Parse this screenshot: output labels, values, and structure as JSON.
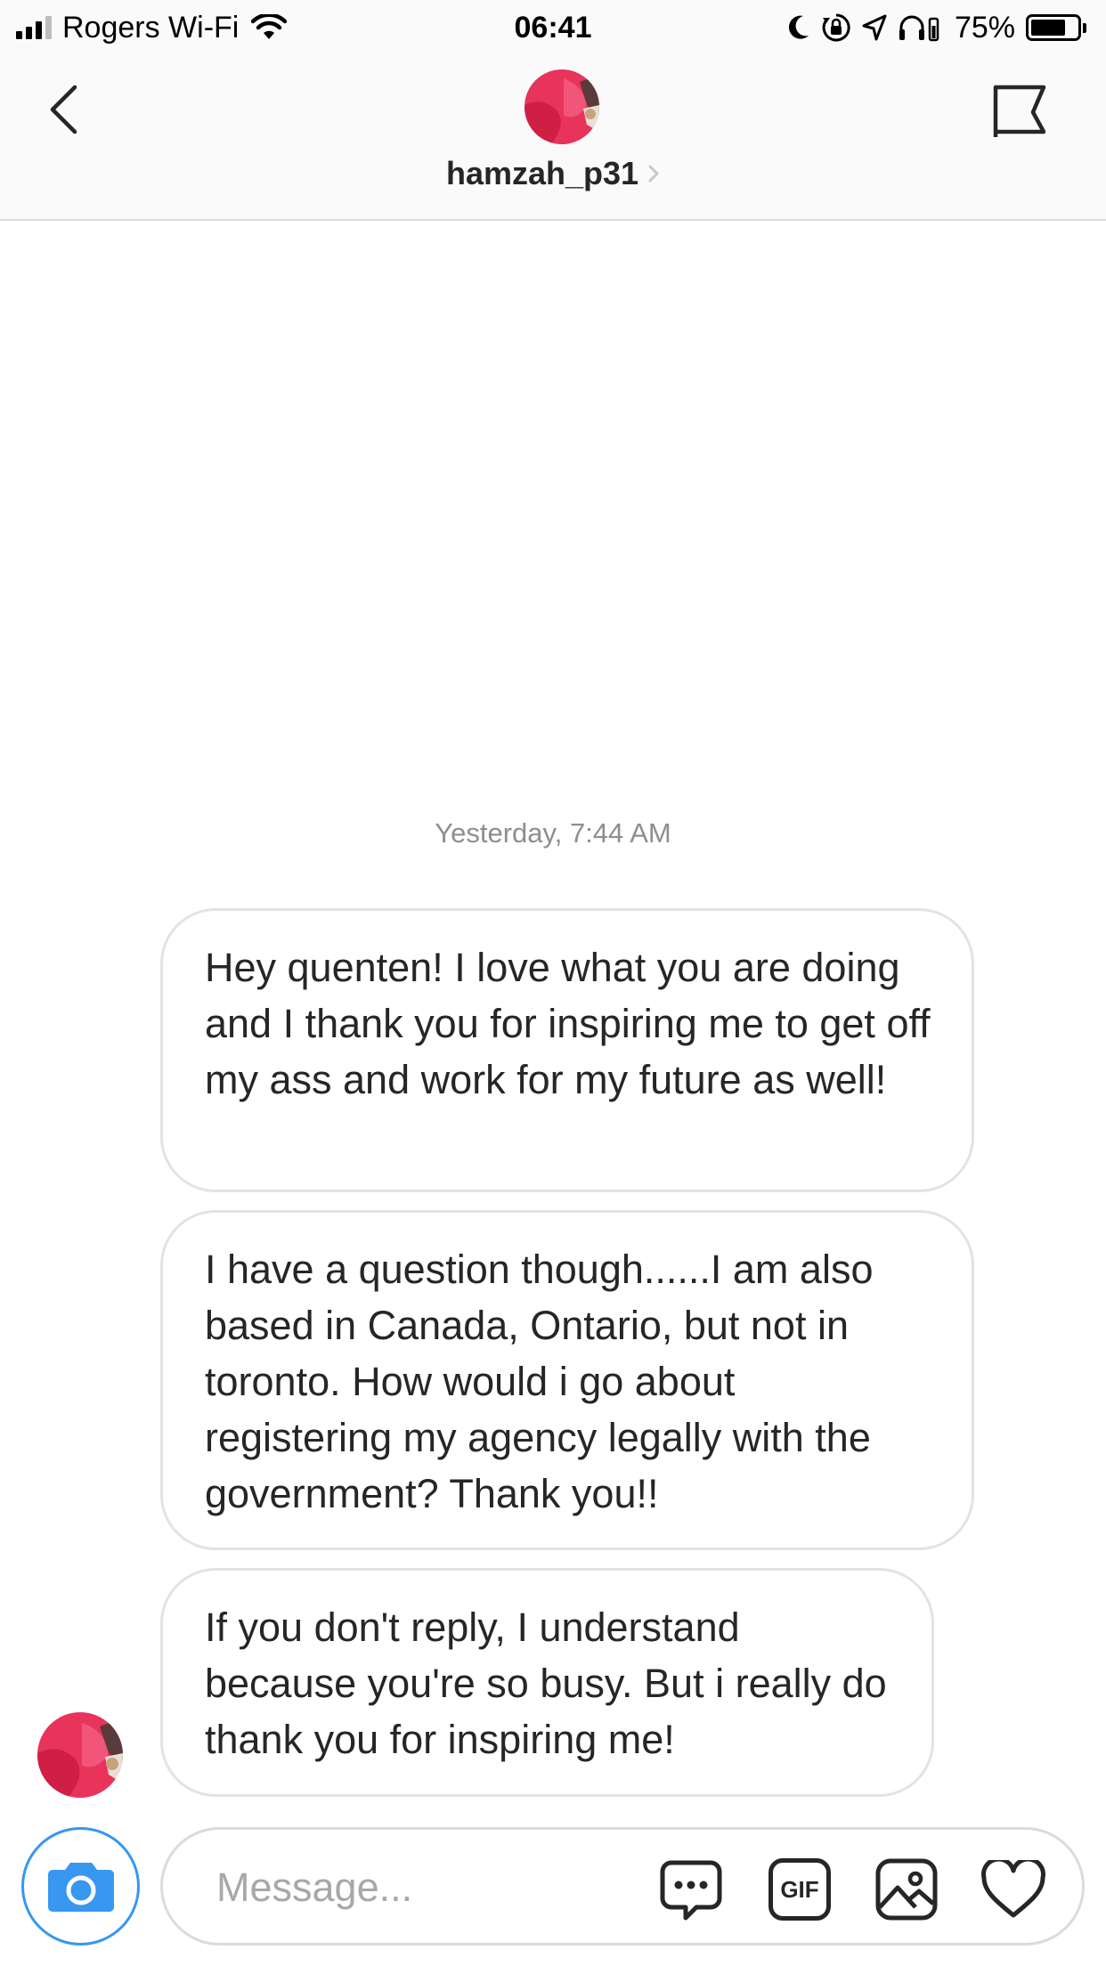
{
  "status_bar": {
    "carrier": "Rogers Wi-Fi",
    "time": "06:41",
    "battery_percent": "75%",
    "battery_level": 0.75,
    "icons": [
      "signal-icon",
      "wifi-icon",
      "moon-icon",
      "orientation-lock-icon",
      "location-icon",
      "headphones-icon",
      "battery-icon"
    ]
  },
  "header": {
    "username": "hamzah_p31",
    "icons": [
      "back-arrow-icon",
      "avatar",
      "chevron-right-icon",
      "flag-icon"
    ]
  },
  "conversation": {
    "timestamp": "Yesterday, 7:44 AM",
    "messages": [
      {
        "text": "Hey quenten! I love what you are doing and I thank you for inspiring me to get off my ass and work for my future as well!"
      },
      {
        "text": "I have a question though......I am also based in Canada, Ontario, but not in toronto. How would i go about registering my agency legally with the government? Thank you!!"
      },
      {
        "text": "If you don't reply, I understand because you're so busy. But i really do thank you for inspiring me!"
      }
    ]
  },
  "composer": {
    "placeholder": "Message...",
    "value": "",
    "gif_label": "GIF",
    "icons": [
      "camera-icon",
      "sticker-icon",
      "gif-icon",
      "gallery-icon",
      "heart-icon"
    ]
  },
  "colors": {
    "accent": "#3897f0",
    "bubble_border": "#e3e3e3",
    "timestamp": "#8e8e8e",
    "avatar": "#e8335a"
  }
}
